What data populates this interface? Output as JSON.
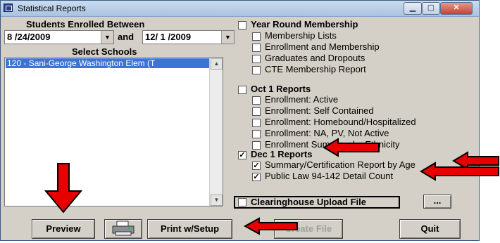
{
  "window": {
    "title": "Statistical Reports",
    "close_glyph": "✕"
  },
  "enrollment": {
    "heading": "Students Enrolled Between",
    "start_date": "8 /24/2009",
    "and_label": "and",
    "end_date": "12/ 1 /2009"
  },
  "schools": {
    "heading": "Select Schools",
    "items": [
      "120 - Sani-George Washington Elem (T"
    ]
  },
  "year_round": {
    "label": "Year Round Membership",
    "checked": false,
    "items": [
      {
        "label": "Membership Lists",
        "checked": false
      },
      {
        "label": "Enrollment and Membership",
        "checked": false
      },
      {
        "label": "Graduates and Dropouts",
        "checked": false
      },
      {
        "label": "CTE Membership Report",
        "checked": false
      }
    ]
  },
  "oct1": {
    "label": "Oct 1 Reports",
    "checked": false,
    "items": [
      {
        "label": "Enrollment: Active",
        "checked": false
      },
      {
        "label": "Enrollment: Self Contained",
        "checked": false
      },
      {
        "label": "Enrollment: Homebound/Hospitalized",
        "checked": false
      },
      {
        "label": "Enrollment: NA, PV, Not Active",
        "checked": false
      },
      {
        "label": "Enrollment Summary by Ethnicity",
        "checked": false
      }
    ]
  },
  "dec1": {
    "label": "Dec 1 Reports",
    "checked": true,
    "items": [
      {
        "label": "Summary/Certification Report by Age",
        "checked": true
      },
      {
        "label": "Public Law 94-142 Detail Count",
        "checked": true
      }
    ]
  },
  "clearinghouse": {
    "label": "Clearinghouse Upload File",
    "checked": false,
    "browse_label": "..."
  },
  "buttons": {
    "preview": "Preview",
    "print_setup": "Print w/Setup",
    "create_file": "Create File",
    "quit": "Quit"
  },
  "colors": {
    "annotation_arrow": "#e60000",
    "selection": "#3c73d6"
  }
}
